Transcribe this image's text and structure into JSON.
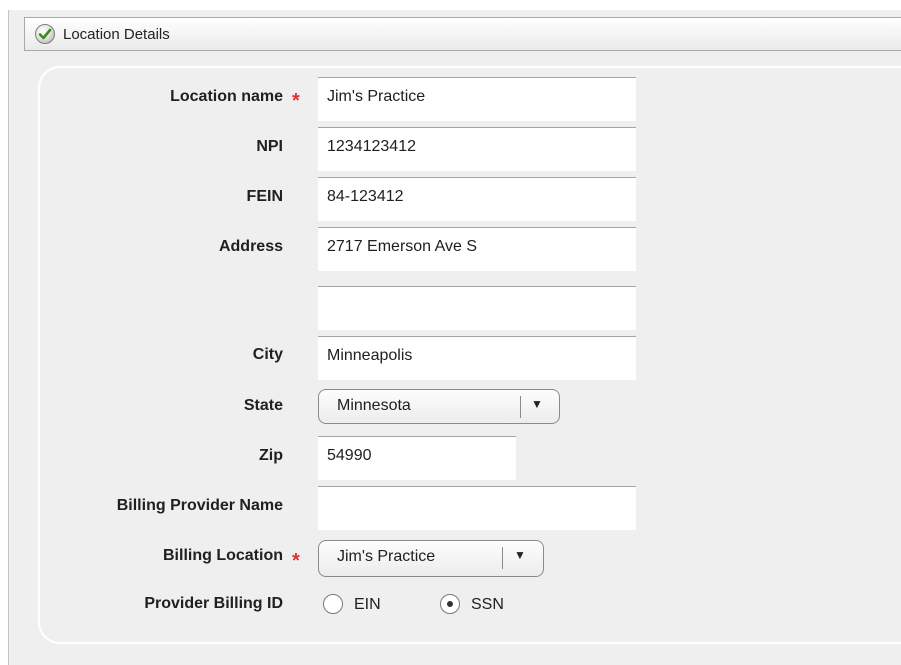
{
  "header": {
    "title": "Location Details",
    "icon": "check-icon"
  },
  "form": {
    "location_name": {
      "label": "Location name",
      "required": "*",
      "value": "Jim's Practice"
    },
    "npi": {
      "label": "NPI",
      "value": "1234123412"
    },
    "fein": {
      "label": "FEIN",
      "value": "84-123412"
    },
    "address": {
      "label": "Address",
      "value": "2717 Emerson Ave S",
      "line2_value": ""
    },
    "city": {
      "label": "City",
      "value": "Minneapolis"
    },
    "state": {
      "label": "State",
      "selected": "Minnesota"
    },
    "zip": {
      "label": "Zip",
      "value": "54990"
    },
    "billing_provider_name": {
      "label": "Billing Provider Name",
      "value": ""
    },
    "billing_location": {
      "label": "Billing Location",
      "required": "*",
      "selected": "Jim's Practice"
    },
    "provider_billing_id": {
      "label": "Provider Billing ID",
      "options": [
        {
          "label": "EIN",
          "checked": false
        },
        {
          "label": "SSN",
          "checked": true
        }
      ]
    }
  },
  "colors": {
    "required": "#e03030",
    "check": "#3a8a1c"
  }
}
